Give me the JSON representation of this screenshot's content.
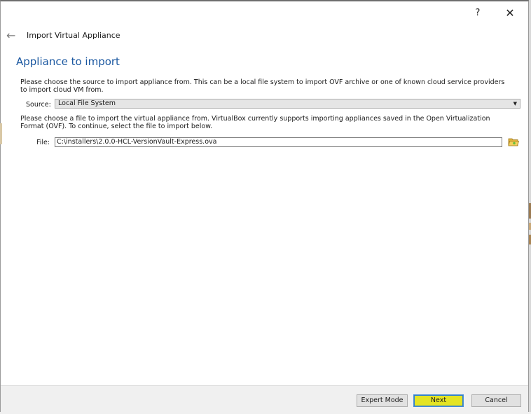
{
  "window": {
    "help_label": "?",
    "close_label": "✕",
    "back_label": "←",
    "dialog_title": "Import Virtual Appliance"
  },
  "page": {
    "heading": "Appliance to import",
    "source_description": "Please choose the source to import appliance from. This can be a local file system to import OVF archive or one of known cloud service providers to import cloud VM from.",
    "file_description": "Please choose a file to import the virtual appliance from. VirtualBox currently supports importing appliances saved in the Open Virtualization Format (OVF). To continue, select the file to import below."
  },
  "source": {
    "label": "Source:",
    "selected": "Local File System",
    "arrow": "▼"
  },
  "file": {
    "label": "File:",
    "value": "C:\\installers\\2.0.0-HCL-VersionVault-Express.ova",
    "browse_icon": "folder-open-icon"
  },
  "footer": {
    "expert_label": "Expert Mode",
    "next_label": "Next",
    "cancel_label": "Cancel"
  },
  "colors": {
    "heading": "#1a57a0",
    "next_highlight": "#e4e423"
  }
}
